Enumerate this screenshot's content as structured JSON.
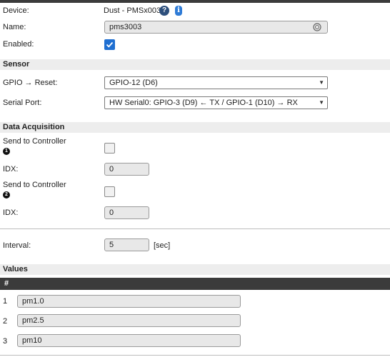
{
  "device": {
    "label": "Device:",
    "value": "Dust - PMSx003",
    "help_glyph": "?",
    "info_glyph": "i"
  },
  "name": {
    "label": "Name:",
    "value": "pms3003"
  },
  "enabled": {
    "label": "Enabled:",
    "checked": true
  },
  "sensor": {
    "title": "Sensor",
    "gpio_label": "GPIO → Reset:",
    "gpio_value": "GPIO-12 (D6)",
    "serial_label": "Serial Port:",
    "serial_value": "HW Serial0: GPIO-3 (D9) ← TX / GPIO-1 (D10) → RX"
  },
  "data_acquisition": {
    "title": "Data Acquisition",
    "controllers": [
      {
        "label": "Send to Controller",
        "number": "1",
        "checked": false,
        "idx_label": "IDX:",
        "idx_value": "0"
      },
      {
        "label": "Send to Controller",
        "number": "2",
        "checked": false,
        "idx_label": "IDX:",
        "idx_value": "0"
      }
    ]
  },
  "interval": {
    "label": "Interval:",
    "value": "5",
    "unit": "[sec]"
  },
  "values": {
    "title": "Values",
    "header_hash": "#",
    "rows": [
      {
        "num": "1",
        "name": "pm1.0"
      },
      {
        "num": "2",
        "name": "pm2.5"
      },
      {
        "num": "3",
        "name": "pm10"
      }
    ]
  },
  "colors": {
    "accent": "#1f6fd1",
    "dark_header": "#3b3b3b",
    "section_bg": "#ededed"
  },
  "icons": [
    "help-icon",
    "info-icon",
    "checkmark-icon",
    "chevron-down-icon",
    "field-badge-icon"
  ]
}
